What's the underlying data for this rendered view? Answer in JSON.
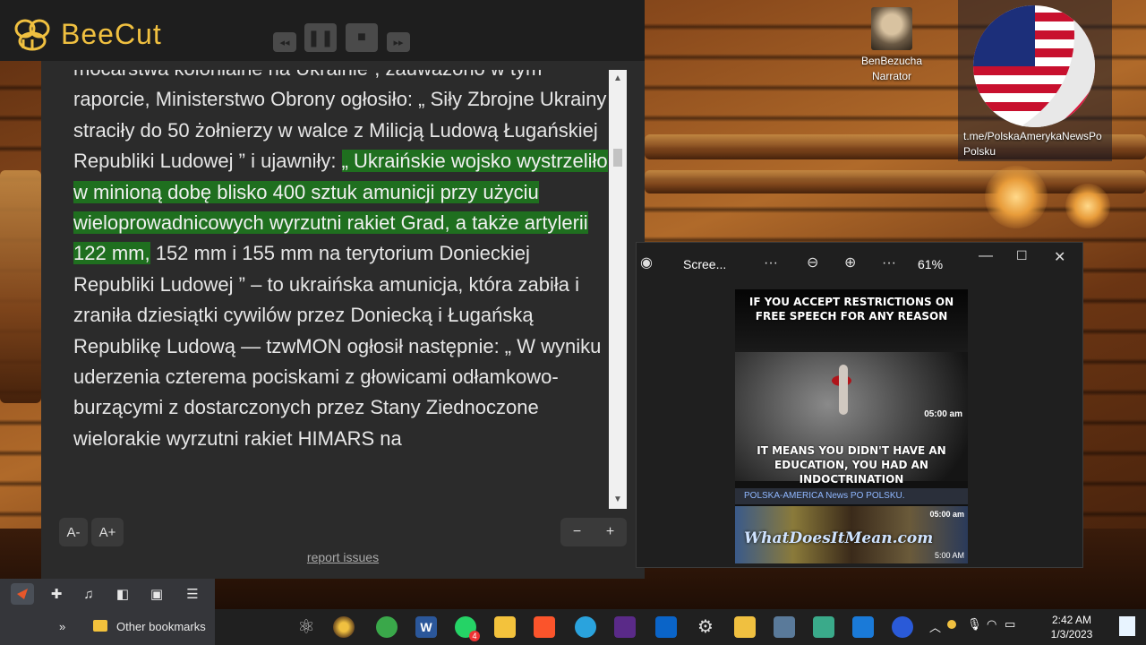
{
  "desktop": {
    "narrator_icon": {
      "name": "BenBezucha",
      "role": "Narrator"
    },
    "telegram_icon": {
      "label": "t.me/PolskaAmerykaNewsPo Polsku"
    }
  },
  "beecut": {
    "title": "BeeCut",
    "controls": {
      "rewind": "◂◂",
      "pause": "❚❚",
      "stop": "■",
      "forward": "▸▸"
    }
  },
  "reader": {
    "text_before_highlight": "mocarstwa kolonialne na Ukrainie”, zauważono w tym raporcie, Ministerstwo Obrony ogłosiło: „ Siły Zbrojne Ukrainy straciły do 50 żołnierzy w walce z Milicją Ludową Ługańskiej Republiki Ludowej ” i ujawniły: ",
    "highlighted_text": "„ Ukraińskie wojsko wystrzeliło w minioną dobę blisko 400 sztuk amunicji przy użyciu wieloprowadnicowych wyrzutni rakiet Grad, a także artylerii 122 mm,",
    "text_after_highlight": " 152 mm i 155 mm na terytorium Donieckiej Republiki Ludowej ” – to ukraińska amunicja, która zabiła i zraniła dziesiątki cywilów przez Doniecką  i Ługańską Republikę Ludową — tzwMON ogłosił następnie: „ W wyniku uderzenia czterema pociskami z głowicami odłamkowo-burzącymi z dostarczonych przez Stany Ziednoczone wielorakie wyrzutni rakiet HIMARS na",
    "font_minus": "A-",
    "font_plus": "A+",
    "speed_minus": "−",
    "speed_plus": "+",
    "report_link": "report issues"
  },
  "bookmarks": {
    "chevron": "»",
    "folder_label": "Other bookmarks"
  },
  "viewer": {
    "title": "Scree...",
    "more1": "···",
    "more2": "···",
    "zoom": "61%",
    "meme_top_caption": "IF YOU ACCEPT RESTRICTIONS ON FREE SPEECH FOR ANY REASON",
    "meme_bottom_caption": "IT MEANS YOU DIDN'T HAVE AN EDUCATION, YOU HAD AN INDOCTRINATION",
    "meme_time": "05:00 am",
    "channel": "POLSKA-AMERICA News PO POLSKU.",
    "brand": "WhatDoesItMean.com",
    "time2": "05:00 am",
    "time3": "5:00 AM"
  },
  "taskbar": {
    "time": "2:42 AM",
    "date": "1/3/2023",
    "whatsapp_badge": "4"
  },
  "colors": {
    "highlight": "#1f6f1f",
    "beecut_gold": "#f0c040"
  }
}
